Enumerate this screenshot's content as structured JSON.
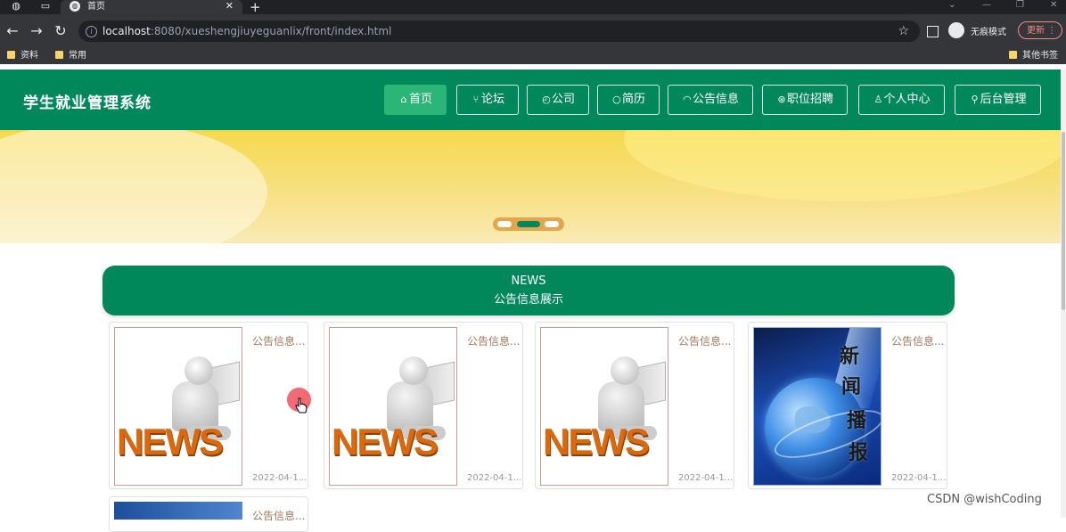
{
  "browser": {
    "tab_title": "首页",
    "url_host": "localhost",
    "url_rest": ":8080/xueshengjiuyeguanlix/front/index.html",
    "incognito_label": "无痕模式",
    "update_label": "更新",
    "bookmarks": [
      "资料",
      "常用"
    ],
    "other_bookmarks": "其他书签"
  },
  "site": {
    "title": "学生就业管理系统",
    "nav": [
      {
        "icon": "⌂",
        "label": "首页"
      },
      {
        "icon": "⑂",
        "label": "论坛"
      },
      {
        "icon": "◴",
        "label": "公司"
      },
      {
        "icon": "○",
        "label": "简历"
      },
      {
        "icon": "◠",
        "label": "公告信息"
      },
      {
        "icon": "⊛",
        "label": "职位招聘"
      },
      {
        "icon": "♙",
        "label": "个人中心"
      },
      {
        "icon": "⚲",
        "label": "后台管理"
      }
    ],
    "active_nav_index": 0
  },
  "banner": {
    "slide_count": 3,
    "active_slide": 1
  },
  "news": {
    "heading_en": "NEWS",
    "heading_cn": "公告信息展示",
    "cards": [
      {
        "category": "公告信息...",
        "date": "2022-04-1...",
        "image": "news-illustration"
      },
      {
        "category": "公告信息...",
        "date": "2022-04-1...",
        "image": "news-illustration"
      },
      {
        "category": "公告信息...",
        "date": "2022-04-1...",
        "image": "news-illustration"
      },
      {
        "category": "公告信息...",
        "date": "2022-04-1...",
        "image": "globe-news-illustration"
      },
      {
        "category": "公告信息...",
        "date": "",
        "image": "globe-news-illustration"
      }
    ],
    "globe_chars": [
      "新",
      "闻",
      "播",
      "报"
    ]
  },
  "watermark": "CSDN @wishCoding",
  "colors": {
    "brand_green": "#00885b",
    "active_nav": "#2bb677",
    "banner_yellow": "#f6d94e"
  }
}
